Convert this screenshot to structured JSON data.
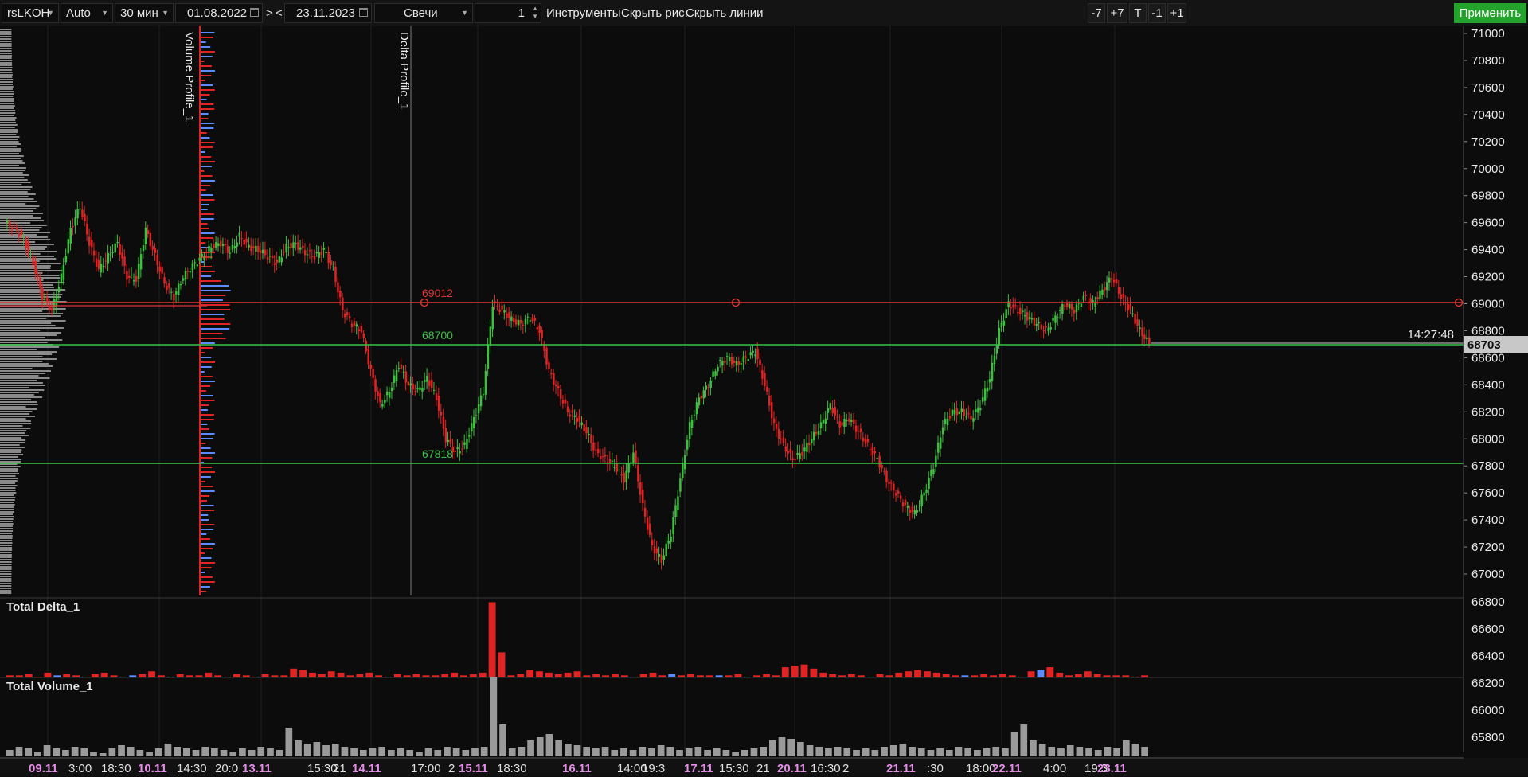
{
  "toolbar": {
    "symbol": "rsLKOH",
    "scale_mode": "Auto",
    "timeframe": "30 мин",
    "date_from": "01.08.2022",
    "nav_forward": ">",
    "nav_back": "<",
    "date_to": "23.11.2023",
    "chart_type": "Свечи",
    "count": "1",
    "tools": "Инструменты",
    "hide_drawings": "Скрыть рис.",
    "hide_lines": "Скрыть линии",
    "minus7": "-7",
    "plus7": "+7",
    "t_btn": "T",
    "minus1": "-1",
    "plus1": "+1",
    "apply": "Применить"
  },
  "indicators": {
    "volume_profile": "Volume Profile_1",
    "delta_profile": "Delta Profile_1",
    "total_delta": "Total Delta_1",
    "total_volume": "Total Volume_1"
  },
  "levels": [
    {
      "label": "69012",
      "price": 69012,
      "color": "#e03434"
    },
    {
      "label": "68700",
      "price": 68700,
      "color": "#39c246"
    },
    {
      "label": "67818",
      "price": 67818,
      "color": "#39c246"
    }
  ],
  "current": {
    "price_label": "68703",
    "price": 68703,
    "timer": "14:27:48"
  },
  "colors": {
    "up": "#3fbf3f",
    "down": "#e02424",
    "background": "#0c0c0c",
    "apply_green": "#23a32b"
  },
  "chart_data": {
    "type": "candlestick",
    "price_axis_ticks": [
      71000,
      70800,
      70600,
      70400,
      70200,
      70000,
      69800,
      69600,
      69400,
      69200,
      69000,
      68800,
      68600,
      68400,
      68200,
      68000,
      67800,
      67600,
      67400,
      67200,
      67000
    ],
    "ylim": [
      66860,
      71050
    ],
    "indicator_axis_ticks": [
      "66800",
      "66600",
      "66400",
      "66200",
      "66000",
      "65800"
    ],
    "time_axis": [
      {
        "text": "09.11",
        "date": true
      },
      {
        "text": "3:00",
        "date": false
      },
      {
        "text": "18:30",
        "date": false
      },
      {
        "text": "10.11",
        "date": true
      },
      {
        "text": "14:30",
        "date": false
      },
      {
        "text": "20:0",
        "date": false
      },
      {
        "text": "13.11",
        "date": true
      },
      {
        "text": "15:30",
        "date": false
      },
      {
        "text": "21",
        "date": false
      },
      {
        "text": "14.11",
        "date": true
      },
      {
        "text": "17:00",
        "date": false
      },
      {
        "text": "2",
        "date": false
      },
      {
        "text": "15.11",
        "date": true
      },
      {
        "text": "18:30",
        "date": false
      },
      {
        "text": "16.11",
        "date": true
      },
      {
        "text": "14:00",
        "date": false
      },
      {
        "text": "19:3",
        "date": false
      },
      {
        "text": "17.11",
        "date": true
      },
      {
        "text": "15:30",
        "date": false
      },
      {
        "text": "21",
        "date": false
      },
      {
        "text": "20.11",
        "date": true
      },
      {
        "text": "16:30",
        "date": false
      },
      {
        "text": "2",
        "date": false
      },
      {
        "text": "21.11",
        "date": true
      },
      {
        "text": ":30",
        "date": false
      },
      {
        "text": "18:00",
        "date": false
      },
      {
        "text": "22.11",
        "date": true
      },
      {
        "text": "4:00",
        "date": false
      },
      {
        "text": "19:3",
        "date": false
      },
      {
        "text": "23.11",
        "date": true
      }
    ],
    "price_path": [
      69600,
      69560,
      69480,
      69300,
      69050,
      68950,
      69200,
      69550,
      69720,
      69450,
      69250,
      69350,
      69450,
      69200,
      69180,
      69550,
      69350,
      69150,
      69050,
      69200,
      69280,
      69350,
      69420,
      69450,
      69380,
      69500,
      69420,
      69400,
      69350,
      69300,
      69420,
      69440,
      69380,
      69350,
      69400,
      69250,
      68950,
      68850,
      68800,
      68500,
      68250,
      68350,
      68550,
      68400,
      68350,
      68450,
      68300,
      68000,
      67900,
      67950,
      68150,
      68350,
      69000,
      68950,
      68880,
      68850,
      68900,
      68800,
      68500,
      68350,
      68200,
      68150,
      68050,
      67900,
      67850,
      67800,
      67700,
      67900,
      67500,
      67200,
      67100,
      67300,
      67700,
      68100,
      68300,
      68400,
      68550,
      68600,
      68550,
      68600,
      68650,
      68400,
      68100,
      67950,
      67850,
      67900,
      68000,
      68100,
      68250,
      68100,
      68150,
      68050,
      67950,
      67850,
      67700,
      67600,
      67500,
      67450,
      67600,
      67800,
      68100,
      68200,
      68200,
      68150,
      68250,
      68450,
      68800,
      69000,
      68950,
      68900,
      68850,
      68800,
      68900,
      69000,
      68950,
      69050,
      69000,
      69100,
      69200,
      69050,
      68950,
      68800,
      68703
    ],
    "delta_values": [
      1,
      1,
      2,
      0,
      3,
      -1,
      2,
      1,
      0,
      2,
      3,
      1,
      0,
      -1,
      2,
      4,
      1,
      0,
      2,
      1,
      1,
      3,
      1,
      0,
      2,
      1,
      0,
      2,
      1,
      1,
      6,
      5,
      3,
      2,
      4,
      3,
      1,
      2,
      3,
      1,
      0,
      2,
      1,
      2,
      1,
      1,
      2,
      3,
      1,
      2,
      3,
      55,
      18,
      1,
      2,
      5,
      4,
      3,
      2,
      3,
      4,
      1,
      2,
      1,
      2,
      1,
      0,
      2,
      3,
      1,
      -2,
      1,
      2,
      1,
      1,
      -1,
      1,
      2,
      0,
      1,
      2,
      1,
      7,
      8,
      9,
      6,
      3,
      2,
      1,
      2,
      1,
      0,
      2,
      1,
      3,
      4,
      5,
      4,
      3,
      2,
      1,
      -1,
      1,
      2,
      1,
      2,
      1,
      0,
      4,
      -5,
      7,
      3,
      1,
      2,
      4,
      2,
      1,
      1,
      1,
      0,
      1
    ],
    "volume_values": [
      4,
      6,
      5,
      3,
      7,
      5,
      4,
      6,
      5,
      3,
      2,
      5,
      7,
      6,
      4,
      3,
      5,
      8,
      6,
      5,
      4,
      6,
      5,
      4,
      3,
      5,
      4,
      6,
      5,
      4,
      18,
      10,
      8,
      9,
      7,
      8,
      6,
      5,
      4,
      5,
      6,
      4,
      5,
      4,
      3,
      5,
      4,
      6,
      5,
      4,
      5,
      6,
      50,
      20,
      5,
      6,
      10,
      12,
      14,
      10,
      8,
      7,
      6,
      5,
      6,
      4,
      5,
      4,
      6,
      5,
      7,
      6,
      4,
      5,
      6,
      4,
      5,
      4,
      3,
      4,
      5,
      6,
      10,
      12,
      11,
      9,
      7,
      6,
      5,
      6,
      5,
      4,
      5,
      4,
      6,
      7,
      8,
      6,
      5,
      4,
      5,
      4,
      6,
      5,
      4,
      5,
      6,
      5,
      15,
      20,
      10,
      8,
      6,
      5,
      7,
      6,
      5,
      4,
      6,
      5,
      10,
      8,
      6
    ]
  }
}
